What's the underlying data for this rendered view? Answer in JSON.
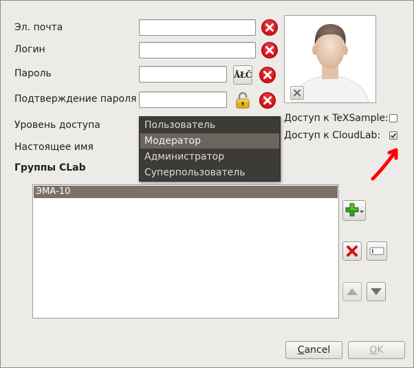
{
  "form": {
    "email_label": "Эл. почта",
    "login_label": "Логин",
    "password_label": "Пароль",
    "confirm_label": "Подтверждение пароля",
    "access_level_label": "Уровень доступа",
    "real_name_label": "Настоящее имя",
    "groups_label": "Группы CLab",
    "email_value": "",
    "login_value": "",
    "password_value": "",
    "confirm_value": "",
    "keyboard_layout_text": "ÅŁČ"
  },
  "access": {
    "texsample_label": "Доступ к TeXSample:",
    "texsample_checked": false,
    "cloudlab_label": "Доступ к CloudLab:",
    "cloudlab_checked": true
  },
  "access_dropdown": {
    "options": [
      "Пользователь",
      "Модератор",
      "Администратор",
      "Суперпользователь"
    ],
    "highlighted": "Модератор"
  },
  "groups": {
    "items": [
      "ЭМА-10"
    ]
  },
  "buttons": {
    "cancel_prefix": "",
    "cancel_mnemonic": "C",
    "cancel_rest": "ancel",
    "ok_mnemonic": "O",
    "ok_rest": "K"
  },
  "colors": {
    "clear_red": "#d8141a",
    "add_green": "#3c9b1e",
    "annotation_arrow": "#ff0000",
    "selection": "#6c655d",
    "menu_bg": "#3c3b37"
  },
  "icons": {
    "clear": "red-x-circle-icon",
    "keyboard": "keyboard-layout-icon",
    "lock": "padlock-open-icon",
    "avatar": "default-avatar-icon",
    "add": "green-plus-icon",
    "remove": "red-x-icon",
    "edit": "rename-field-icon",
    "up": "arrow-up-icon",
    "down": "arrow-down-icon"
  }
}
